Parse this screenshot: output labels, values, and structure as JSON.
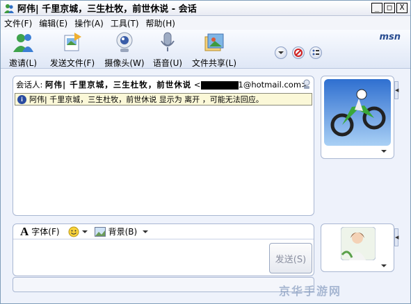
{
  "window": {
    "title": "阿伟| 千里京城，三生杜牧，前世休说 - 会话",
    "buttons": [
      "_",
      "□",
      "X"
    ]
  },
  "menu": [
    {
      "label": "文件(F)"
    },
    {
      "label": "编辑(E)"
    },
    {
      "label": "操作(A)"
    },
    {
      "label": "工具(T)"
    },
    {
      "label": "帮助(H)"
    }
  ],
  "toolbar": {
    "invite": "邀请(L)",
    "send_file": "发送文件(F)",
    "webcam": "摄像头(W)",
    "voice": "语音(U)",
    "share": "文件共享(L)",
    "logo": "msn"
  },
  "conversation": {
    "to_label": "会话人:",
    "contact_name": "阿伟| 千里京城，三生杜牧，前世休说",
    "email_suffix": "1@hotmail.com>",
    "email_prefix": "<",
    "status_message": "阿伟| 千里京城，三生杜牧，前世休说 显示为 离开 ，可能无法回应。"
  },
  "compose": {
    "font_label": "字体(F)",
    "background_label": "背景(B)",
    "send_label": "发送(S)"
  },
  "watermark": "京华手游网",
  "colors": {
    "accent": "#274b8f",
    "panel_border": "#a8b6d2",
    "info_bg": "#fbf8d8"
  }
}
